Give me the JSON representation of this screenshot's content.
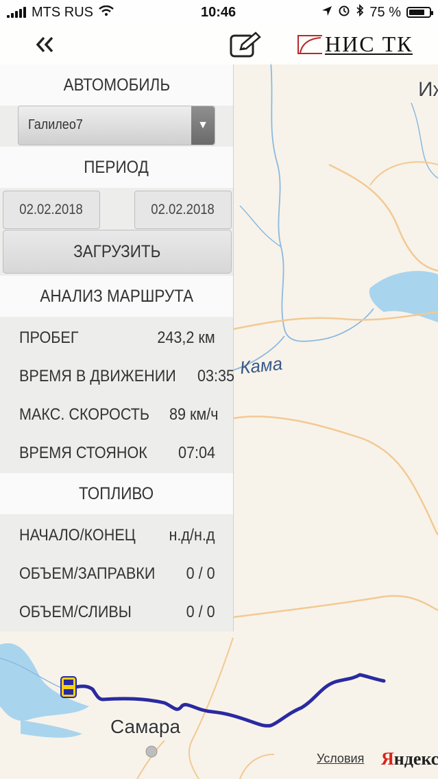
{
  "status_bar": {
    "carrier": "MTS RUS",
    "time": "10:46",
    "battery_text": "75 %",
    "battery_level": 0.75
  },
  "app_bar": {
    "back_icon": "double-chevron-left-icon",
    "edit_icon": "edit-icon",
    "logo_text": "НИС ТК"
  },
  "panel": {
    "vehicle_header": "АВТОМОБИЛЬ",
    "vehicle_selected": "Галилео7",
    "period_header": "ПЕРИОД",
    "date_from": "02.02.2018",
    "date_to": "02.02.2018",
    "load_button": "ЗАГРУЗИТЬ",
    "analysis_header": "АНАЛИЗ МАРШРУТА",
    "stats": [
      {
        "label": "ПРОБЕГ",
        "value": "243,2 км"
      },
      {
        "label": "ВРЕМЯ В ДВИЖЕНИИ",
        "value": "03:35"
      },
      {
        "label": "МАКС. СКОРОСТЬ",
        "value": "89 км/ч"
      },
      {
        "label": "ВРЕМЯ СТОЯНОК",
        "value": "07:04"
      }
    ],
    "fuel_header": "ТОПЛИВО",
    "fuel_stats": [
      {
        "label": "НАЧАЛО/КОНЕЦ",
        "value": "н.д/н.д"
      },
      {
        "label": "ОБЪЕМ/ЗАПРАВКИ",
        "value": "0 / 0"
      },
      {
        "label": "ОБЪЕМ/СЛИВЫ",
        "value": "0 / 0"
      }
    ]
  },
  "map": {
    "river_label": "Кама",
    "city_label": "Самара",
    "partial_label": "Иж",
    "terms_link": "Условия",
    "provider_first": "Я",
    "provider_rest": "ндекс",
    "route_color": "#2a2aa0"
  }
}
